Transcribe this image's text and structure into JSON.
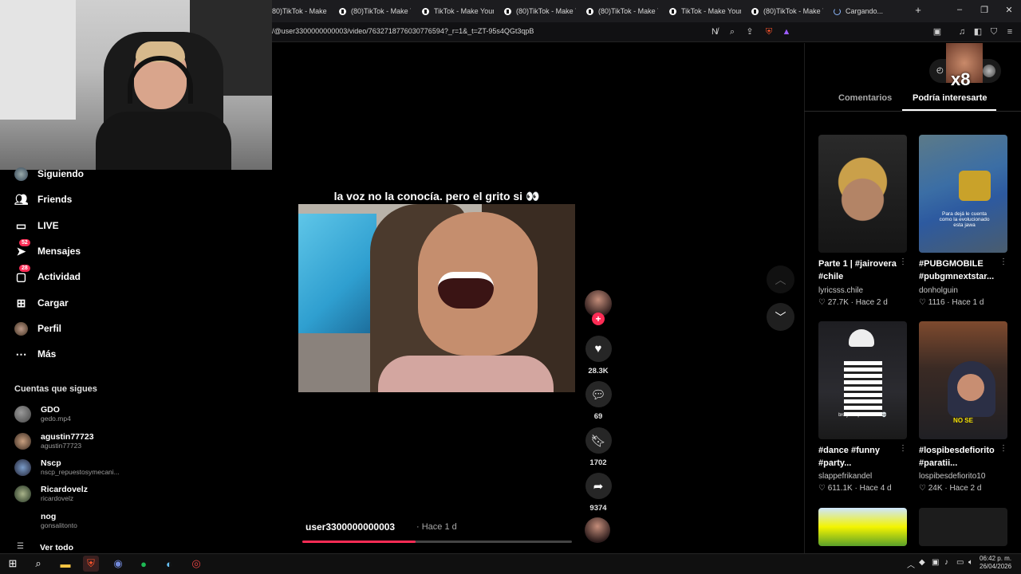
{
  "browser": {
    "tabs": [
      {
        "label": "80)TikTok - Make Y"
      },
      {
        "label": "(80)TikTok - Make Y"
      },
      {
        "label": "TikTok - Make Your"
      },
      {
        "label": "(80)TikTok - Make Y"
      },
      {
        "label": "(80)TikTok - Make Y"
      },
      {
        "label": "TikTok - Make Your"
      },
      {
        "label": "(80)TikTok - Make Y"
      },
      {
        "label": "Cargando..."
      }
    ],
    "new_tab": "+",
    "url": "/@user3300000000003/video/7632718776030776594?_r=1&_t=ZT-95s4QGt3qpB"
  },
  "sidebar": {
    "items": [
      {
        "label": "Siguiendo",
        "icon": "following-avatar-icon"
      },
      {
        "label": "Friends",
        "icon": "friends-icon"
      },
      {
        "label": "LIVE",
        "icon": "live-icon"
      },
      {
        "label": "Mensajes",
        "icon": "messages-icon",
        "badge": "52"
      },
      {
        "label": "Actividad",
        "icon": "activity-icon",
        "badge": "28"
      },
      {
        "label": "Cargar",
        "icon": "upload-icon"
      },
      {
        "label": "Perfil",
        "icon": "profile-avatar-icon"
      },
      {
        "label": "Más",
        "icon": "more-icon"
      }
    ],
    "following_title": "Cuentas que sigues",
    "accounts": [
      {
        "name": "GDO",
        "handle": "gedo.mp4"
      },
      {
        "name": "agustin77723",
        "handle": "agustin77723"
      },
      {
        "name": "Nscp",
        "handle": "nscp_repuestosymecani..."
      },
      {
        "name": "Ricardovelz",
        "handle": "ricardovelz"
      },
      {
        "name": "nog",
        "handle": "gonsalitonto"
      }
    ],
    "see_all": "Ver todo"
  },
  "video": {
    "caption": "la voz no la conocía. pero el grito si 👀",
    "author": "user3300000000003",
    "time": "· Hace 1 d",
    "progress": 0.42,
    "likes": "28.3K",
    "comments": "69",
    "saves": "1702",
    "shares": "9374"
  },
  "panel": {
    "tab_comments": "Comentarios",
    "tab_suggested": "Podría interesarte",
    "overlay_badge": "x8",
    "items": [
      {
        "title": "Parte 1 | #jairovera #chile",
        "author": "lyricsss.chile",
        "likes": "27.7K",
        "time": "Hace 2 d",
        "thumb_text": ""
      },
      {
        "title": "#PUBGMOBILE #pubgmnextstar...",
        "author": "donholguin",
        "likes": "1116",
        "time": "Hace 1 d",
        "thumb_text": "Para dejá le cuenta como la evolucionado esta jawa"
      },
      {
        "title": "#dance #funny #party...",
        "author": "slappefrikandel",
        "likes": "611.1K",
        "time": "Hace 4 d",
        "thumb_text": "bro just spawned in 💀"
      },
      {
        "title": "#lospibesdefiorito #paratii...",
        "author": "lospibesdefiorito10",
        "likes": "24K",
        "time": "Hace 2 d",
        "thumb_text": "NO SE"
      }
    ]
  },
  "taskbar": {
    "time": "06:42 p. m.",
    "date": "26/04/2026"
  },
  "colors": {
    "accent": "#fe2c55",
    "background": "#000000"
  }
}
